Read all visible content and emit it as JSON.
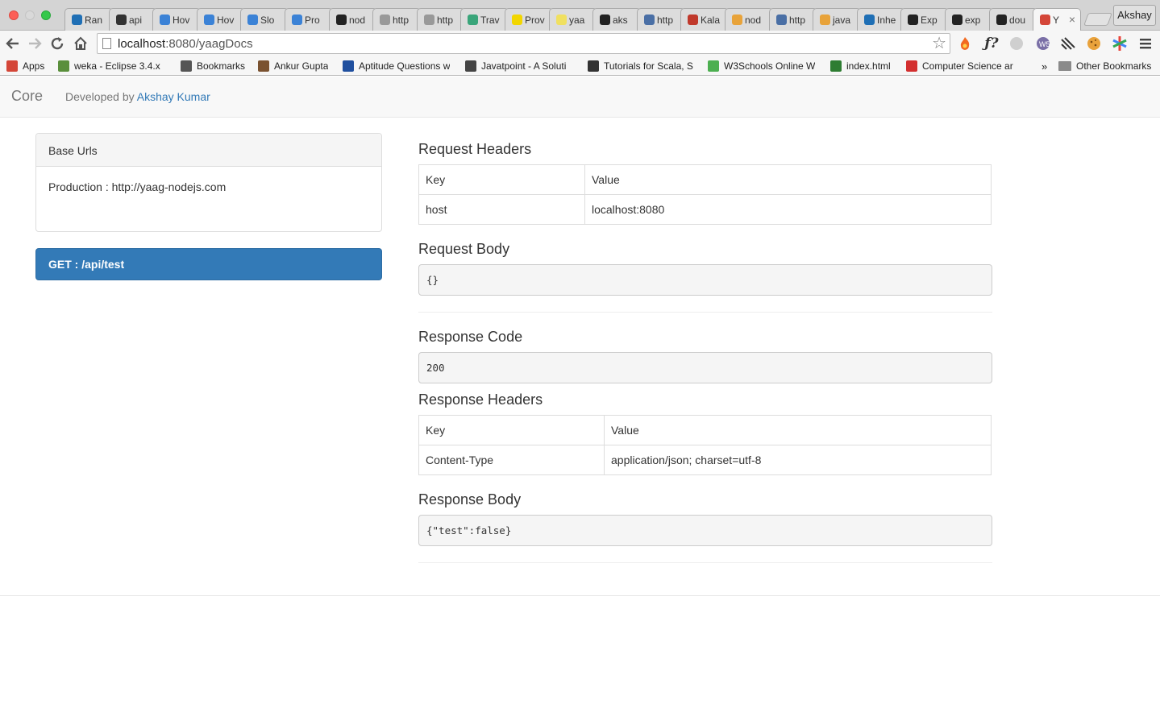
{
  "browser": {
    "tabs": [
      {
        "label": "Ran",
        "color": "#1f6fb5"
      },
      {
        "label": "api",
        "color": "#333333"
      },
      {
        "label": "Hov",
        "color": "#3b82d6"
      },
      {
        "label": "Hov",
        "color": "#3b82d6"
      },
      {
        "label": "Slo",
        "color": "#3b82d6"
      },
      {
        "label": "Pro",
        "color": "#3b82d6"
      },
      {
        "label": "nod",
        "color": "#222222"
      },
      {
        "label": "http",
        "color": "#999999"
      },
      {
        "label": "http",
        "color": "#999999"
      },
      {
        "label": "Trav",
        "color": "#3aa57a"
      },
      {
        "label": "Prov",
        "color": "#f2d600"
      },
      {
        "label": "yaa",
        "color": "#f0e060"
      },
      {
        "label": "aks",
        "color": "#222222"
      },
      {
        "label": "http",
        "color": "#4a6fa5"
      },
      {
        "label": "Kala",
        "color": "#c0392b"
      },
      {
        "label": "nod",
        "color": "#e8a33a"
      },
      {
        "label": "http",
        "color": "#4a6fa5"
      },
      {
        "label": "java",
        "color": "#e8a33a"
      },
      {
        "label": "Inhe",
        "color": "#1f6fb5"
      },
      {
        "label": "Exp",
        "color": "#222222"
      },
      {
        "label": "exp",
        "color": "#222222"
      },
      {
        "label": "dou",
        "color": "#222222"
      },
      {
        "label": "Y",
        "color": "#d44638"
      }
    ],
    "profile_name": "Akshay",
    "url_host": "localhost",
    "url_rest": ":8080/yaagDocs",
    "bookmarks": [
      {
        "label": "Apps",
        "color": "#d44638"
      },
      {
        "label": "weka - Eclipse 3.4.x",
        "color": "#5a8f3c"
      },
      {
        "label": "Bookmarks",
        "color": "#555555"
      },
      {
        "label": "Ankur Gupta",
        "color": "#7a5230"
      },
      {
        "label": "Aptitude Questions w",
        "color": "#1f4f9f"
      },
      {
        "label": "Javatpoint - A Soluti",
        "color": "#444444"
      },
      {
        "label": "Tutorials for Scala, S",
        "color": "#333333"
      },
      {
        "label": "W3Schools Online W",
        "color": "#4caf50"
      },
      {
        "label": "index.html",
        "color": "#2e7d32"
      },
      {
        "label": "Computer Science ar",
        "color": "#d32f2f"
      }
    ],
    "bookmarks_more": "»",
    "other_bookmarks": "Other Bookmarks"
  },
  "navbar": {
    "brand": "Core",
    "developed_by": "Developed by",
    "author": "Akshay Kumar"
  },
  "sidebar": {
    "panel_title": "Base Urls",
    "production_label": "Production : http://yaag-nodejs.com",
    "endpoint": "GET : /api/test"
  },
  "main": {
    "request_headers_title": "Request Headers",
    "request_headers": {
      "col_key": "Key",
      "col_value": "Value",
      "rows": [
        {
          "key": "host",
          "value": "localhost:8080"
        }
      ]
    },
    "request_body_title": "Request Body",
    "request_body": "{}",
    "response_code_title": "Response Code",
    "response_code": "200",
    "response_headers_title": "Response Headers",
    "response_headers": {
      "col_key": "Key",
      "col_value": "Value",
      "rows": [
        {
          "key": "Content-Type",
          "value": "application/json; charset=utf-8"
        }
      ]
    },
    "response_body_title": "Response Body",
    "response_body": "{\"test\":false}"
  }
}
